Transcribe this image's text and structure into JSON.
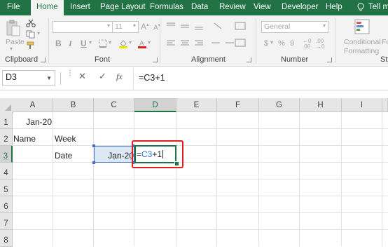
{
  "tabs": [
    {
      "label": "File",
      "active": false
    },
    {
      "label": "Home",
      "active": true
    },
    {
      "label": "Insert",
      "active": false
    },
    {
      "label": "Page Layout",
      "active": false
    },
    {
      "label": "Formulas",
      "active": false
    },
    {
      "label": "Data",
      "active": false
    },
    {
      "label": "Review",
      "active": false
    },
    {
      "label": "View",
      "active": false
    },
    {
      "label": "Developer",
      "active": false
    },
    {
      "label": "Help",
      "active": false
    },
    {
      "label": "Tell me",
      "active": false
    }
  ],
  "ribbon": {
    "clipboard": {
      "paste_label": "Paste",
      "group_label": "Clipboard"
    },
    "font": {
      "font_name": "",
      "font_size": "11",
      "group_label": "Font",
      "bold": "B",
      "italic": "I",
      "underline": "U"
    },
    "alignment": {
      "group_label": "Alignment"
    },
    "number": {
      "format": "General",
      "currency": "$",
      "percent": "%",
      "comma": "9",
      "group_label": "Number"
    },
    "styles": {
      "conditional_formatting": "Conditional Formatting",
      "format_as": "Fo",
      "group_label": "Sty"
    }
  },
  "formula_bar": {
    "name_box": "D3",
    "cancel": "✕",
    "enter": "✓",
    "fx": "fx",
    "formula": "=C3+1"
  },
  "columns": [
    "A",
    "B",
    "C",
    "D",
    "E",
    "F",
    "G",
    "H",
    "I"
  ],
  "rows": [
    "1",
    "2",
    "3",
    "4",
    "5",
    "6",
    "7",
    "8"
  ],
  "cells": {
    "A1": "Jan-20",
    "A2": "Name",
    "B2": "Week",
    "B3": "Date",
    "C3": "Jan-20",
    "D3": {
      "prefix": "=",
      "ref": "C3",
      "suffix": "+1"
    }
  },
  "selected": {
    "cell": "D3",
    "column": "D",
    "row": "3"
  },
  "colors": {
    "ribbon_green": "#217346",
    "highlight_red": "#e02020",
    "ref_blue": "#4472c4"
  }
}
